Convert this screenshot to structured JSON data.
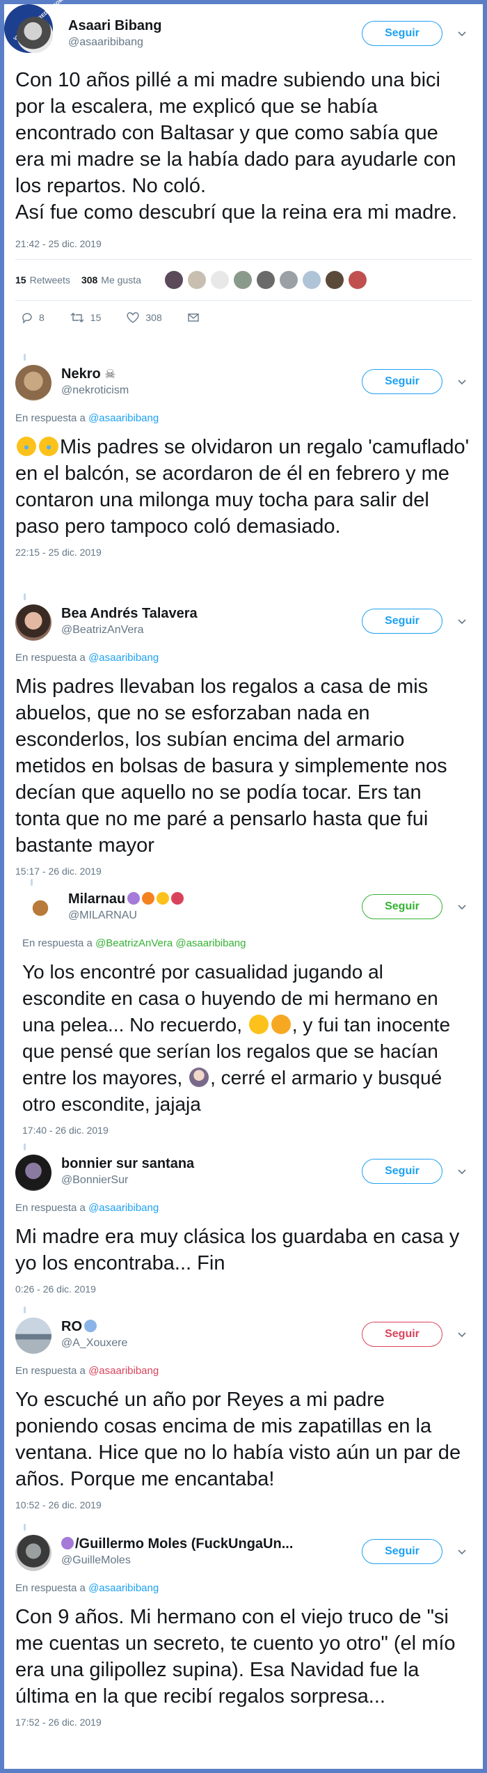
{
  "watermark": "VISTOENLASREDES.COM",
  "follow_label": "Seguir",
  "tweets": [
    {
      "name": "Asaari Bibang",
      "handle": "@asaaribibang",
      "text": "Con 10 años pillé a mi madre subiendo una bici por la escalera, me explicó que se había encontrado con Baltasar y que como sabía que era mi madre se la había dado para ayudarle con los repartos. No coló.\nAsí fue como descubrí que la reina era mi madre.",
      "time": "21:42 - 25 dic. 2019",
      "retweets_count": "15",
      "retweets_label": "Retweets",
      "likes_count": "308",
      "likes_label": "Me gusta",
      "reply_count": "8",
      "rt_count": "15",
      "like_count": "308"
    },
    {
      "name": "Nekro",
      "name_emoji": "skull",
      "handle": "@nekroticism",
      "reply_prefix": "En respuesta a",
      "reply_to": "@asaaribibang",
      "text_emoji": "laughing-crying x2",
      "text": "Mis padres se olvidaron un regalo 'camuflado' en el balcón, se acordaron de él en febrero y me contaron una milonga muy tocha para salir del paso pero tampoco coló demasiado.",
      "time": "22:15 - 25 dic. 2019"
    },
    {
      "name": "Bea Andrés Talavera",
      "handle": "@BeatrizAnVera",
      "reply_prefix": "En respuesta a",
      "reply_to": "@asaaribibang",
      "text": "Mis padres llevaban los regalos a casa de mis abuelos, que no se esforzaban nada en esconderlos, los subían encima del armario metidos en bolsas de basura y simplemente nos decían que aquello no se podía tocar. Ers tan tonta que no me paré a pensarlo hasta que fui bastante mayor",
      "time": "15:17 - 26 dic. 2019"
    },
    {
      "name": "Milarnau",
      "handle": "@MILARNAU",
      "reply_prefix": "En respuesta a",
      "reply_to": "@BeatrizAnVera @asaaribibang",
      "text_1": "Yo los encontré por casualidad jugando al escondite en casa o huyendo de mi hermano en una pelea... No recuerdo,",
      "text_2": ", y fui tan inocente que pensé que serían los regalos que se hacían entre los mayores,",
      "text_3": ", cerré el armario y busqué otro escondite, jajaja",
      "time": "17:40 - 26 dic. 2019"
    },
    {
      "name": "bonnier sur santana",
      "handle": "@BonnierSur",
      "reply_prefix": "En respuesta a",
      "reply_to": "@asaaribibang",
      "text": "Mi madre era muy clásica los guardaba en casa y yo los encontraba... Fin",
      "time": "0:26 - 26 dic. 2019"
    },
    {
      "name": "RO",
      "handle": "@A_Xouxere",
      "reply_prefix": "En respuesta a",
      "reply_to": "@asaaribibang",
      "text": "Yo escuché un año por Reyes a mi padre poniendo cosas encima de mis zapatillas en la ventana. Hice que no lo había visto aún un par de años. Porque me encantaba!",
      "time": "10:52 - 26 dic. 2019"
    },
    {
      "name": "/Guillermo Moles (FuckUngaUn...",
      "handle": "@GuilleMoles",
      "reply_prefix": "En respuesta a",
      "reply_to": "@asaaribibang",
      "text": "Con 9 años. Mi hermano con el viejo truco de \"si me cuentas un secreto, te cuento yo otro\" (el mío era una gilipollez supina). Esa Navidad fue la última en la que recibí regalos sorpresa...",
      "time": "17:52 - 26 dic. 2019"
    }
  ],
  "colors": {
    "link": "#1da1f2",
    "follow_green": "#34b233",
    "follow_red": "#d8435b",
    "frame": "#5b7fc7"
  }
}
